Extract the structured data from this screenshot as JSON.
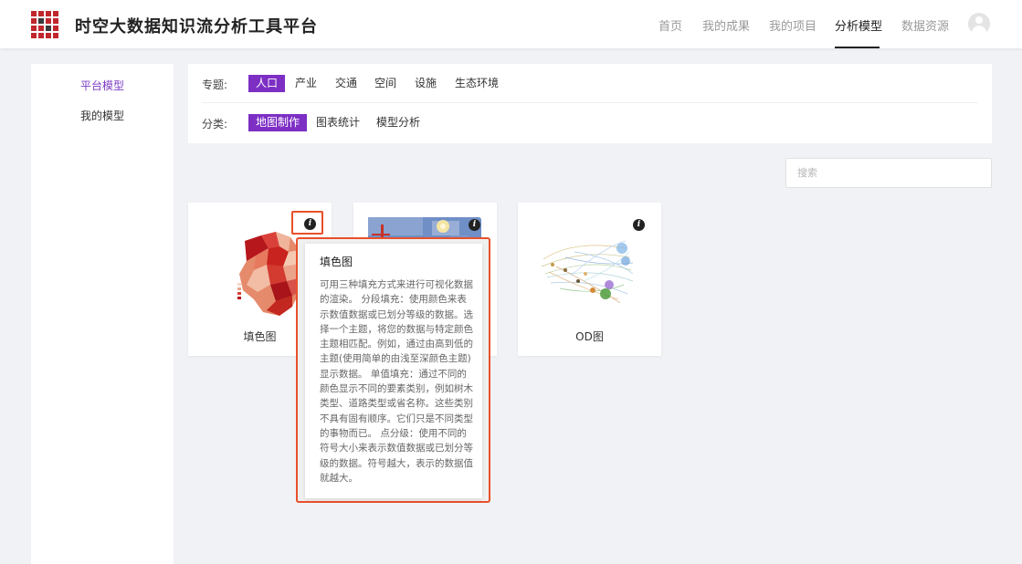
{
  "app": {
    "title": "时空大数据知识流分析工具平台",
    "brand_colors": {
      "primary": "#7d2fc4",
      "logo_red": "#c0272d",
      "highlight": "#e8502b"
    }
  },
  "nav": {
    "items": [
      "首页",
      "我的成果",
      "我的项目",
      "分析模型",
      "数据资源"
    ],
    "active": "分析模型",
    "avatar_icon": "user-avatar-icon"
  },
  "sidebar": {
    "items": [
      "平台模型",
      "我的模型"
    ],
    "active": "平台模型"
  },
  "filters": {
    "topic_label": "专题:",
    "topics": [
      "人口",
      "产业",
      "交通",
      "空间",
      "设施",
      "生态环境"
    ],
    "active_topic": "人口",
    "category_label": "分类:",
    "categories": [
      "地图制作",
      "图表统计",
      "模型分析"
    ],
    "active_category": "地图制作"
  },
  "search": {
    "placeholder": "搜索"
  },
  "cards": [
    {
      "label": "填色图",
      "thumbnail": "choropleth-map-thumbnail",
      "icon": "info-icon"
    },
    {
      "label": "",
      "thumbnail": "heat-map-thumbnail",
      "icon": "info-icon"
    },
    {
      "label": "OD图",
      "thumbnail": "od-flow-map-thumbnail",
      "icon": "info-icon"
    }
  ],
  "tooltip": {
    "title": "填色图",
    "body": "可用三种填充方式来进行可视化数据的渲染。 分段填充：使用颜色来表示数值数据或已划分等级的数据。选择一个主题，将您的数据与特定颜色主题相匹配。例如，通过由高到低的主题(使用简单的由浅至深颜色主题)显示数据。 单值填充：通过不同的颜色显示不同的要素类别，例如树木类型、道路类型或省名称。这些类别不具有固有顺序。它们只是不同类型的事物而已。 点分级：使用不同的符号大小来表示数值数据或已划分等级的数据。符号越大，表示的数据值就越大。"
  }
}
